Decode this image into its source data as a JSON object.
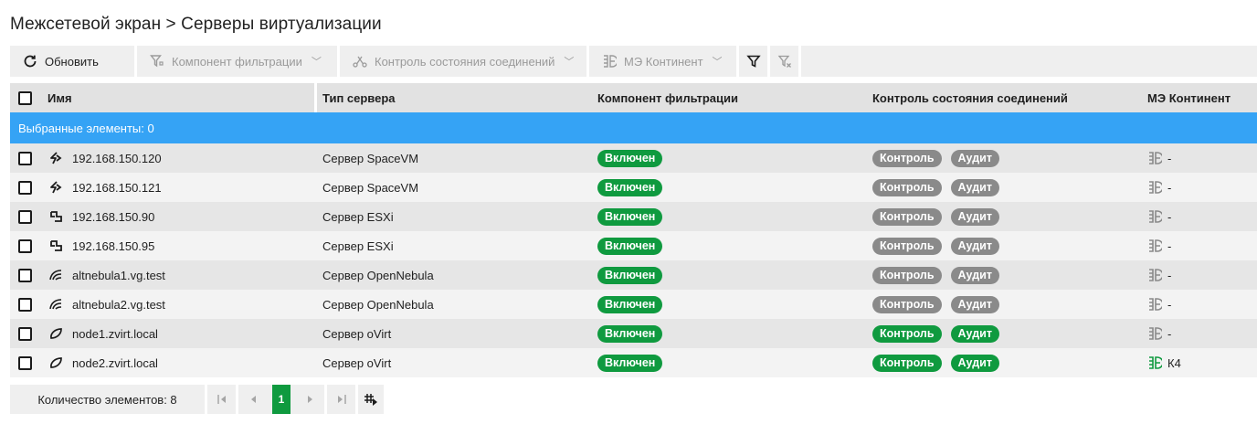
{
  "breadcrumb": "Межсетевой экран > Серверы виртуализации",
  "toolbar": {
    "refresh_label": "Обновить",
    "filter_component_label": "Компонент фильтрации",
    "conn_state_label": "Контроль состояния соединений",
    "me_continent_label": "МЭ Континент"
  },
  "columns": {
    "name": "Имя",
    "type": "Тип сервера",
    "filter": "Компонент фильтрации",
    "ctrl": "Контроль состояния соединений",
    "me": "МЭ Континент"
  },
  "selection_text": "Выбранные элементы: 0",
  "rows": [
    {
      "name": "192.168.150.120",
      "icon": "spacevm-icon",
      "type": "Сервер SpaceVM",
      "filter": "Включен",
      "ctrl": "Контроль",
      "audit": "Аудит",
      "ctrl_active": false,
      "me": "-",
      "me_active": false
    },
    {
      "name": "192.168.150.121",
      "icon": "spacevm-icon",
      "type": "Сервер SpaceVM",
      "filter": "Включен",
      "ctrl": "Контроль",
      "audit": "Аудит",
      "ctrl_active": false,
      "me": "-",
      "me_active": false
    },
    {
      "name": "192.168.150.90",
      "icon": "esxi-icon",
      "type": "Сервер ESXi",
      "filter": "Включен",
      "ctrl": "Контроль",
      "audit": "Аудит",
      "ctrl_active": false,
      "me": "-",
      "me_active": false
    },
    {
      "name": "192.168.150.95",
      "icon": "esxi-icon",
      "type": "Сервер ESXi",
      "filter": "Включен",
      "ctrl": "Контроль",
      "audit": "Аудит",
      "ctrl_active": false,
      "me": "-",
      "me_active": false
    },
    {
      "name": "altnebula1.vg.test",
      "icon": "opennebula-icon",
      "type": "Сервер OpenNebula",
      "filter": "Включен",
      "ctrl": "Контроль",
      "audit": "Аудит",
      "ctrl_active": false,
      "me": "-",
      "me_active": false
    },
    {
      "name": "altnebula2.vg.test",
      "icon": "opennebula-icon",
      "type": "Сервер OpenNebula",
      "filter": "Включен",
      "ctrl": "Контроль",
      "audit": "Аудит",
      "ctrl_active": false,
      "me": "-",
      "me_active": false
    },
    {
      "name": "node1.zvirt.local",
      "icon": "ovirt-icon",
      "type": "Сервер oVirt",
      "filter": "Включен",
      "ctrl": "Контроль",
      "audit": "Аудит",
      "ctrl_active": true,
      "me": "-",
      "me_active": false
    },
    {
      "name": "node2.zvirt.local",
      "icon": "ovirt-icon",
      "type": "Сервер oVirt",
      "filter": "Включен",
      "ctrl": "Контроль",
      "audit": "Аудит",
      "ctrl_active": true,
      "me": "К4",
      "me_active": true
    }
  ],
  "footer": {
    "count_label": "Количество элементов: 8",
    "current_page": "1"
  },
  "colors": {
    "accent_green": "#0f9a3f",
    "selection_blue": "#35a3f5",
    "badge_gray": "#8a8a8a"
  }
}
